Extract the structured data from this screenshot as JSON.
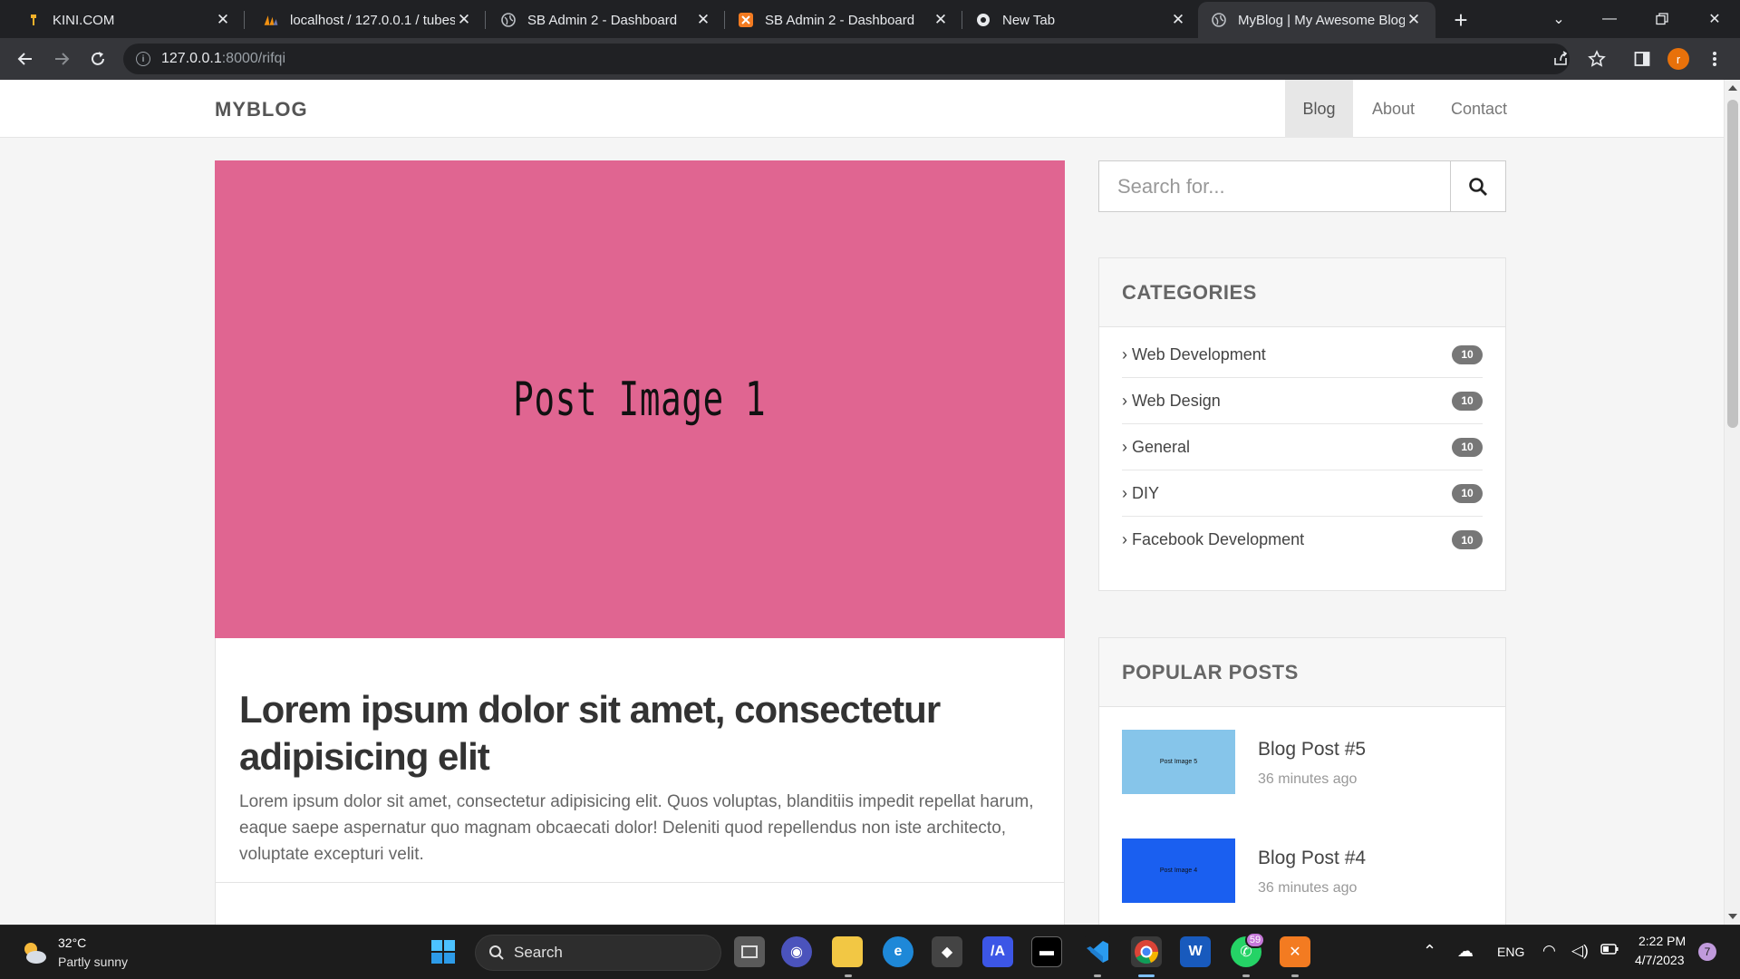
{
  "browser": {
    "tabs": [
      {
        "title": "KINI.COM",
        "icon": "kini-favicon"
      },
      {
        "title": "localhost / 127.0.0.1 / tubes",
        "icon": "phpmyadmin-favicon"
      },
      {
        "title": "SB Admin 2 - Dashboard",
        "icon": "globe-favicon"
      },
      {
        "title": "SB Admin 2 - Dashboard",
        "icon": "xampp-favicon"
      },
      {
        "title": "New Tab",
        "icon": "chrome-favicon"
      },
      {
        "title": "MyBlog | My Awesome Blog",
        "icon": "globe-favicon",
        "active": true
      }
    ],
    "url_host": "127.0.0.1",
    "url_path": ":8000/rifqi",
    "profile_initial": "r"
  },
  "site": {
    "brand": "MYBLOG",
    "nav": [
      {
        "label": "Blog",
        "active": true
      },
      {
        "label": "About"
      },
      {
        "label": "Contact"
      }
    ],
    "featured_post": {
      "image_label": "Post Image 1",
      "image_color": "#e06591",
      "title": "Lorem ipsum dolor sit amet, consectetur adipisicing elit",
      "excerpt": "Lorem ipsum dolor sit amet, consectetur adipisicing elit. Quos voluptas, blanditiis impedit repellat harum, eaque saepe aspernatur quo magnam obcaecati dolor! Deleniti quod repellendus non iste architecto, voluptate excepturi velit."
    },
    "search": {
      "placeholder": "Search for..."
    },
    "categories": {
      "heading": "CATEGORIES",
      "items": [
        {
          "label": "Web Development",
          "count": "10"
        },
        {
          "label": "Web Design",
          "count": "10"
        },
        {
          "label": "General",
          "count": "10"
        },
        {
          "label": "DIY",
          "count": "10"
        },
        {
          "label": "Facebook Development",
          "count": "10"
        }
      ]
    },
    "popular": {
      "heading": "POPULAR POSTS",
      "items": [
        {
          "title": "Blog Post #5",
          "time": "36 minutes ago",
          "thumb_label": "Post Image 5",
          "thumb_color": "#86c5ea"
        },
        {
          "title": "Blog Post #4",
          "time": "36 minutes ago",
          "thumb_label": "Post Image 4",
          "thumb_color": "#1a5ff0"
        }
      ]
    }
  },
  "taskbar": {
    "weather_temp": "32°C",
    "weather_desc": "Partly sunny",
    "search_label": "Search",
    "whatsapp_badge": "59",
    "language": "ENG",
    "time": "2:22 PM",
    "date": "4/7/2023",
    "notification_count": "7"
  },
  "colors": {
    "accent_orange": "#e8710a",
    "taskbar_bg": "#1c1c1c",
    "chrome_bg": "#202124"
  }
}
